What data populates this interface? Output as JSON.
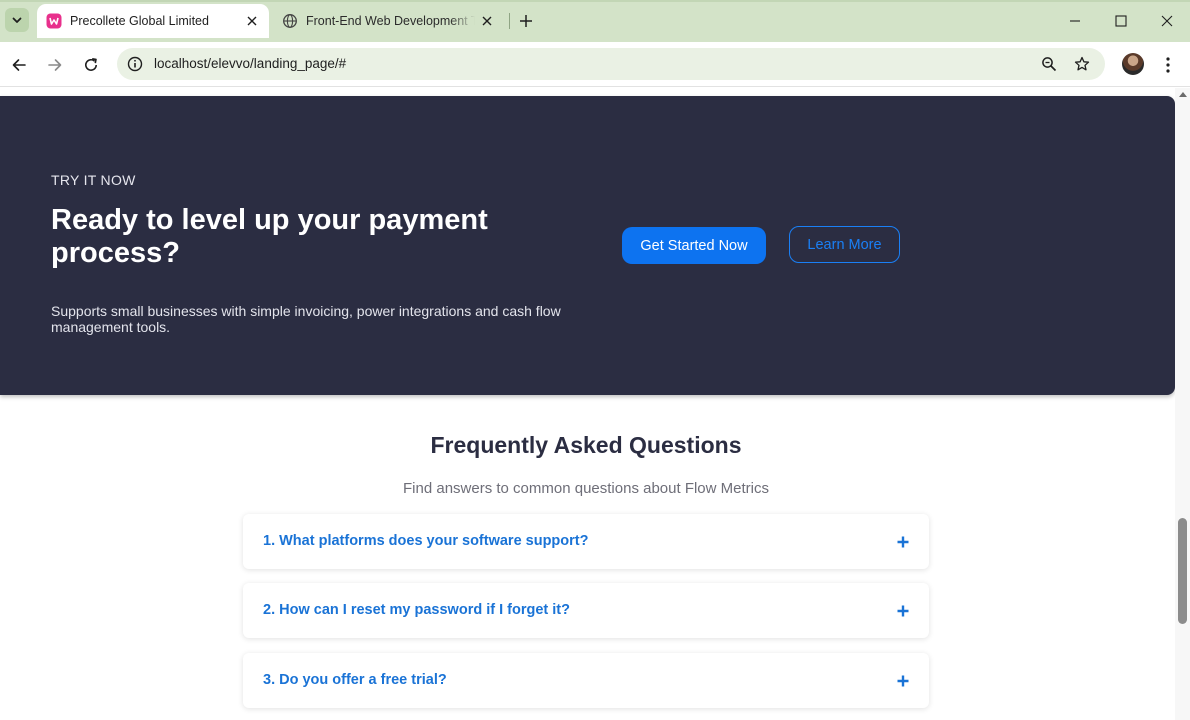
{
  "browser": {
    "tabs": [
      {
        "title": "Precollete Global Limited",
        "active": true
      },
      {
        "title": "Front-End Web Development Te",
        "active": false
      }
    ],
    "url": "localhost/elevvo/landing_page/#"
  },
  "cta": {
    "eyebrow": "TRY IT NOW",
    "title": "Ready to level up your payment process?",
    "description": "Supports small businesses with simple invoicing, power integrations and cash flow management tools.",
    "primary_button": "Get Started Now",
    "secondary_button": "Learn More"
  },
  "faq": {
    "title": "Frequently Asked Questions",
    "subtitle": "Find answers to common questions about Flow Metrics",
    "items": [
      {
        "question": "1. What platforms does your software support?"
      },
      {
        "question": "2. How can I reset my password if I forget it?"
      },
      {
        "question": "3. Do you offer a free trial?"
      }
    ]
  },
  "colors": {
    "cta_background": "#2b2d42",
    "primary_button": "#0d73f0",
    "faq_question": "#1a73d6",
    "tab_strip": "#d3e3c8"
  }
}
